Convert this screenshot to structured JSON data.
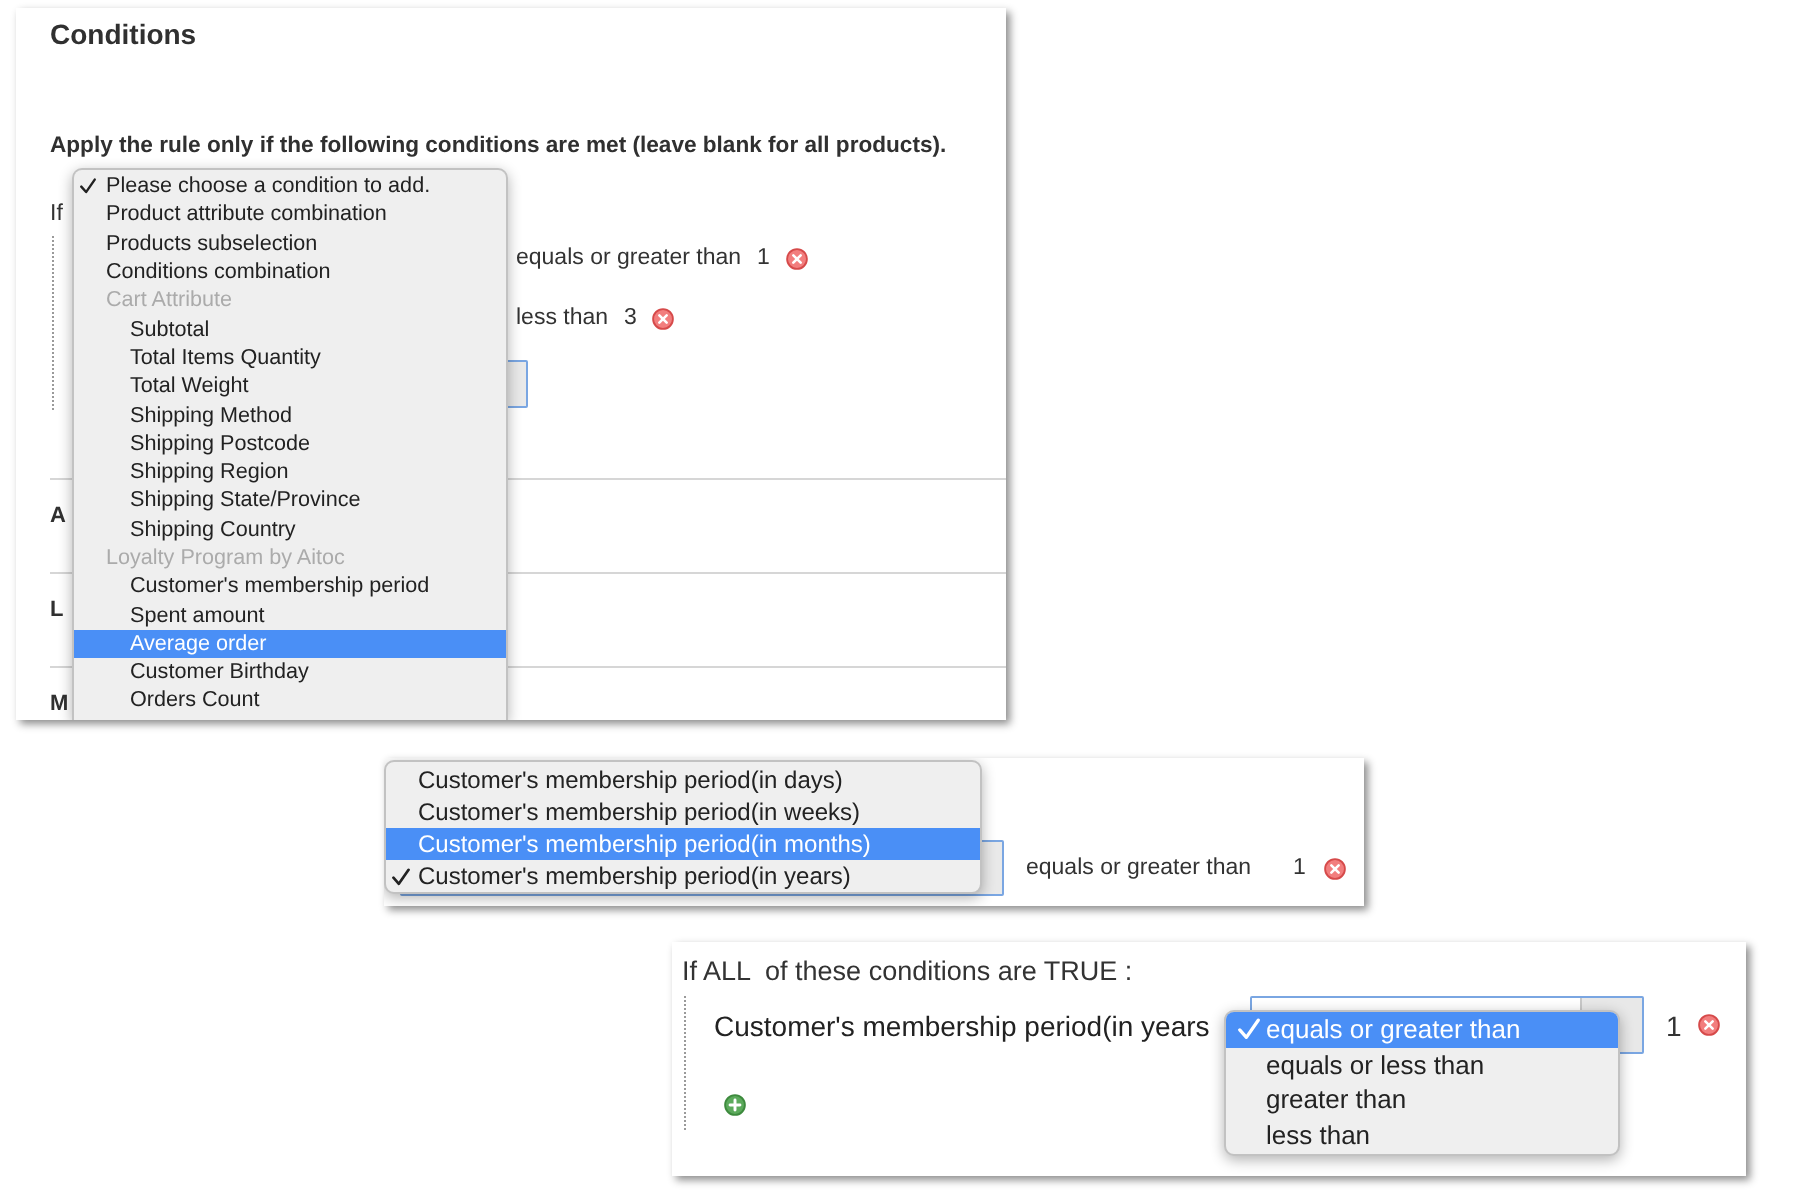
{
  "conditions_panel": {
    "title": "Conditions",
    "intro": "Apply the rule only if the following conditions are met (leave blank for all products).",
    "if_label": "If",
    "conditions": [
      {
        "operator": "equals or greater than",
        "value": "1"
      },
      {
        "operator": "less than",
        "value": "3"
      }
    ],
    "sections": [
      "A",
      "L",
      "M"
    ],
    "condition_menu": [
      {
        "kind": "option",
        "label": "Please choose a condition to add.",
        "selected": true,
        "highlighted": false
      },
      {
        "kind": "option",
        "label": "Product attribute combination",
        "selected": false,
        "highlighted": false
      },
      {
        "kind": "option",
        "label": "Products subselection",
        "selected": false,
        "highlighted": false
      },
      {
        "kind": "option",
        "label": "Conditions combination",
        "selected": false,
        "highlighted": false
      },
      {
        "kind": "group",
        "label": "Cart Attribute",
        "children": [
          {
            "label": "Subtotal",
            "selected": false,
            "highlighted": false
          },
          {
            "label": "Total Items Quantity",
            "selected": false,
            "highlighted": false
          },
          {
            "label": "Total Weight",
            "selected": false,
            "highlighted": false
          },
          {
            "label": "Shipping Method",
            "selected": false,
            "highlighted": false
          },
          {
            "label": "Shipping Postcode",
            "selected": false,
            "highlighted": false
          },
          {
            "label": "Shipping Region",
            "selected": false,
            "highlighted": false
          },
          {
            "label": "Shipping State/Province",
            "selected": false,
            "highlighted": false
          },
          {
            "label": "Shipping Country",
            "selected": false,
            "highlighted": false
          }
        ]
      },
      {
        "kind": "group",
        "label": "Loyalty Program by Aitoc",
        "children": [
          {
            "label": "Customer's membership period",
            "selected": false,
            "highlighted": false
          },
          {
            "label": "Spent amount",
            "selected": false,
            "highlighted": false
          },
          {
            "label": "Average order",
            "selected": false,
            "highlighted": true
          },
          {
            "label": "Customer Birthday",
            "selected": false,
            "highlighted": false
          },
          {
            "label": "Orders Count",
            "selected": false,
            "highlighted": false
          }
        ]
      }
    ]
  },
  "period_panel": {
    "period_menu": [
      {
        "label": "Customer's membership period(in days)",
        "selected": false,
        "highlighted": false
      },
      {
        "label": "Customer's membership period(in weeks)",
        "selected": false,
        "highlighted": false
      },
      {
        "label": "Customer's membership period(in months)",
        "selected": false,
        "highlighted": true
      },
      {
        "label": "Customer's membership period(in years)",
        "selected": true,
        "highlighted": false
      }
    ],
    "operator": "equals or greater than",
    "value": "1"
  },
  "operator_panel": {
    "heading": "If ALL  of these conditions are TRUE :",
    "condition": "Customer's membership period(in years",
    "value": "1",
    "operator_menu": [
      {
        "label": "equals or greater than",
        "selected": true,
        "highlighted": true
      },
      {
        "label": "equals or less than",
        "selected": false,
        "highlighted": false
      },
      {
        "label": "greater than",
        "selected": false,
        "highlighted": false
      },
      {
        "label": "less than",
        "selected": false,
        "highlighted": false
      }
    ]
  }
}
